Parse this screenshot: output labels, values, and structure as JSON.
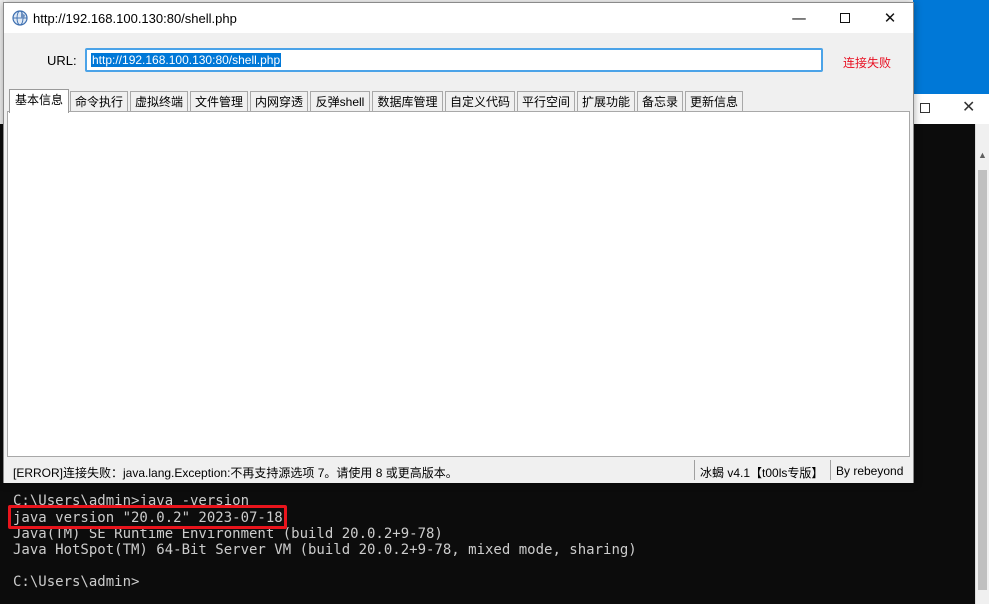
{
  "window": {
    "title": "http://192.168.100.130:80/shell.php",
    "minimize": "—",
    "close": "✕"
  },
  "url_bar": {
    "label": "URL:",
    "value": "http://192.168.100.130:80/shell.php",
    "status": "连接失败"
  },
  "tabs": [
    {
      "label": "基本信息",
      "active": true
    },
    {
      "label": "命令执行"
    },
    {
      "label": "虚拟终端"
    },
    {
      "label": "文件管理"
    },
    {
      "label": "内网穿透"
    },
    {
      "label": "反弹shell"
    },
    {
      "label": "数据库管理"
    },
    {
      "label": "自定义代码"
    },
    {
      "label": "平行空间"
    },
    {
      "label": "扩展功能"
    },
    {
      "label": "备忘录"
    },
    {
      "label": "更新信息"
    }
  ],
  "statusbar": {
    "message": "[ERROR]连接失败：java.lang.Exception:不再支持源选项 7。请使用 8 或更高版本。",
    "version": "冰蝎 v4.1【t00ls专版】",
    "author": "By rebeyond"
  },
  "console": {
    "lines": [
      "C:\\Users\\admin>java -version",
      "java version \"20.0.2\" 2023-07-18",
      "Java(TM) SE Runtime Environment (build 20.0.2+9-78)",
      "Java HotSpot(TM) 64-Bit Server VM (build 20.0.2+9-78, mixed mode, sharing)",
      "C:\\Users\\admin>"
    ],
    "close": "✕"
  },
  "colors": {
    "accent": "#0078d7",
    "error": "#e81123",
    "highlight": "#e8141c",
    "console_bg": "#0c0c0c",
    "console_fg": "#cccccc"
  }
}
